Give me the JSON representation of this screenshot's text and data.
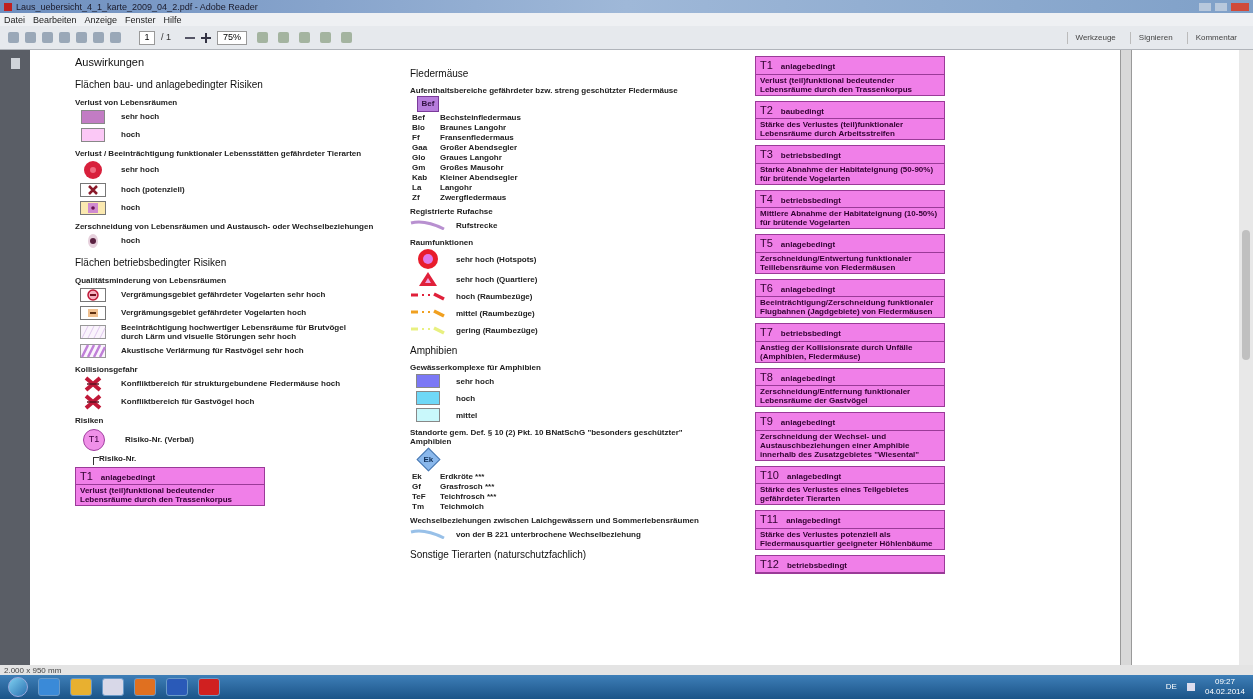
{
  "window": {
    "title": "Laus_uebersicht_4_1_karte_2009_04_2.pdf - Adobe Reader"
  },
  "menu": [
    "Datei",
    "Bearbeiten",
    "Anzeige",
    "Fenster",
    "Hilfe"
  ],
  "toolbar": {
    "page": "1",
    "page_count": "/ 1",
    "zoom": "75%",
    "panels": [
      "Werkzeuge",
      "Signieren",
      "Kommentar"
    ]
  },
  "columns": [
    [
      {
        "kind": "heading",
        "text": "Auswirkungen"
      },
      {
        "kind": "heading2",
        "text": "Flächen bau- und anlagebedingter Risiken"
      },
      {
        "kind": "label",
        "text": "Verlust von Lebensräumen"
      },
      {
        "kind": "swatch",
        "color": "#c27cc4",
        "text": "sehr hoch"
      },
      {
        "kind": "swatch",
        "color": "#fbc8f6",
        "text": "hoch"
      },
      {
        "kind": "label",
        "text": "Verlust / Beeinträchtigung funktionaler Lebensstätten gefährdeter Tierarten"
      },
      {
        "kind": "red-dot",
        "text": "sehr hoch"
      },
      {
        "kind": "cross-box",
        "text": "hoch (potenziell)"
      },
      {
        "kind": "dot-box",
        "text": "hoch"
      },
      {
        "kind": "label",
        "text": "Zerschneidung von Lebensräumen und Austausch- oder Wechselbeziehungen"
      },
      {
        "kind": "small-mark",
        "text": "hoch"
      },
      {
        "kind": "heading2",
        "text": "Flächen betriebsbedingter Risiken"
      },
      {
        "kind": "label",
        "text": "Qualitätsminderung von Lebensräumen"
      },
      {
        "kind": "ring-box",
        "text": "Vergrämungsgebiet gefährdeter Vogelarten sehr hoch"
      },
      {
        "kind": "tan-box",
        "text": "Vergrämungsgebiet gefährdeter Vogelarten hoch"
      },
      {
        "kind": "hatch-light",
        "text": "Beeinträchtigung hochwertiger Lebensräume für Brutvögel durch Lärm und visuelle Störungen sehr hoch"
      },
      {
        "kind": "hatch-dark",
        "text": "Akustische Verlärmung für Rastvögel sehr hoch"
      },
      {
        "kind": "label",
        "text": "Kollisionsgefahr"
      },
      {
        "kind": "red-cross",
        "text": "Konfliktbereich für strukturgebundene Fledermäuse hoch"
      },
      {
        "kind": "red-cross",
        "text": "Konfliktbereich für Gastvögel hoch"
      },
      {
        "kind": "label",
        "text": "Risiken"
      },
      {
        "kind": "marker",
        "code": "T1",
        "text": "Risiko-Nr. (Verbal)"
      },
      {
        "kind": "callout",
        "text": "Risiko-Nr."
      },
      {
        "kind": "card",
        "number": "T1",
        "type": "anlagebedingt",
        "text": "Verlust (teil)funktional bedeutender Lebensräume durch den Trassenkorpus"
      }
    ],
    [
      {
        "kind": "heading2",
        "text": "Fledermäuse"
      },
      {
        "kind": "label",
        "text": "Aufenthaltsbereiche gefährdeter bzw. streng geschützter Fledermäuse"
      },
      {
        "kind": "bat-box",
        "code": "Bef"
      },
      {
        "kind": "abbr",
        "code": "Bef",
        "text": "Bechsteinfledermaus"
      },
      {
        "kind": "abbr",
        "code": "Blo",
        "text": "Braunes Langohr"
      },
      {
        "kind": "abbr",
        "code": "Ff",
        "text": "Fransenfledermaus"
      },
      {
        "kind": "abbr",
        "code": "Gaa",
        "text": "Großer Abendsegler"
      },
      {
        "kind": "abbr",
        "code": "Glo",
        "text": "Graues Langohr"
      },
      {
        "kind": "abbr",
        "code": "Gm",
        "text": "Großes Mausohr"
      },
      {
        "kind": "abbr",
        "code": "Kab",
        "text": "Kleiner Abendsegler"
      },
      {
        "kind": "abbr",
        "code": "La",
        "text": "Langohr"
      },
      {
        "kind": "abbr",
        "code": "Zf",
        "text": "Zwergfledermaus"
      },
      {
        "kind": "label",
        "text": "Registrierte Rufachse"
      },
      {
        "kind": "violet-line",
        "text": "Rufstrecke"
      },
      {
        "kind": "label",
        "text": "Raumfunktionen"
      },
      {
        "kind": "ring",
        "text": "sehr hoch (Hotspots)"
      },
      {
        "kind": "triangle",
        "text": "sehr hoch (Quartiere)"
      },
      {
        "kind": "dash",
        "color": "#e0203a",
        "text": "hoch (Raumbezüge)"
      },
      {
        "kind": "dash",
        "color": "#f0a020",
        "text": "mittel (Raumbezüge)"
      },
      {
        "kind": "dash",
        "color": "#e8f080",
        "text": "gering (Raumbezüge)"
      },
      {
        "kind": "heading2",
        "text": "Amphibien"
      },
      {
        "kind": "label",
        "text": "Gewässerkomplexe für Amphibien"
      },
      {
        "kind": "swatch",
        "color": "#7b78f5",
        "text": "sehr hoch"
      },
      {
        "kind": "swatch",
        "color": "#6fd8f7",
        "text": "hoch"
      },
      {
        "kind": "swatch",
        "color": "#c9f8fb",
        "text": "mittel"
      },
      {
        "kind": "label",
        "text": "Standorte gem. Def. § 10 (2) Pkt. 10 BNatSchG \"besonders geschützter\" Amphibien"
      },
      {
        "kind": "diamond",
        "code": "Ek"
      },
      {
        "kind": "abbr",
        "code": "Ek",
        "text": "Erdkröte ***"
      },
      {
        "kind": "abbr",
        "code": "Gf",
        "text": "Grasfrosch ***"
      },
      {
        "kind": "abbr",
        "code": "TeF",
        "text": "Teichfrosch ***"
      },
      {
        "kind": "abbr",
        "code": "Tm",
        "text": "Teichmolch"
      },
      {
        "kind": "label",
        "text": "Wechselbeziehungen zwischen Laichgewässern und Sommerlebensräumen"
      },
      {
        "kind": "blue-line",
        "text": "von der B 221 unterbrochene Wechselbeziehung"
      },
      {
        "kind": "heading2",
        "text": "Sonstige Tierarten (naturschutzfachlich)"
      }
    ],
    [
      {
        "kind": "card",
        "number": "T1",
        "type": "anlagebedingt",
        "text": "Verlust (teil)funktional bedeutender Lebensräume durch den Trassenkorpus"
      },
      {
        "kind": "card",
        "number": "T2",
        "type": "baubedingt",
        "text": "Stärke des Verlustes (teil)funktionaler Lebensräume durch Arbeitsstreifen"
      },
      {
        "kind": "card",
        "number": "T3",
        "type": "betriebsbedingt",
        "text": "Starke Abnahme der Habitateignung (50-90%) für brütende Vogelarten"
      },
      {
        "kind": "card",
        "number": "T4",
        "type": "betriebsbedingt",
        "text": "Mittlere Abnahme der Habitateignung (10-50%) für brütende Vogelarten"
      },
      {
        "kind": "card",
        "number": "T5",
        "type": "anlagebedingt",
        "text": "Zerschneidung/Entwertung funktionaler Teillebensräume von Fledermäusen"
      },
      {
        "kind": "card",
        "number": "T6",
        "type": "anlagebedingt",
        "text": "Beeinträchtigung/Zerschneidung funktionaler Flugbahnen (Jagdgebiete) von Fledermäusen"
      },
      {
        "kind": "card",
        "number": "T7",
        "type": "betriebsbedingt",
        "text": "Anstieg der Kollisionsrate durch Unfälle (Amphibien, Fledermäuse)"
      },
      {
        "kind": "card",
        "number": "T8",
        "type": "anlagebedingt",
        "text": "Zerschneidung/Entfernung funktionaler Lebensräume der Gastvögel"
      },
      {
        "kind": "card",
        "number": "T9",
        "type": "anlagebedingt",
        "text": "Zerschneidung der Wechsel- und Austauschbeziehungen einer Amphibie innerhalb des Zusatzgebietes \"Wiesental\""
      },
      {
        "kind": "card",
        "number": "T10",
        "type": "anlagebedingt",
        "text": "Stärke des Verlustes eines Teilgebietes gefährdeter Tierarten"
      },
      {
        "kind": "card",
        "number": "T11",
        "type": "anlagebedingt",
        "text": "Stärke des Verlustes potenziell als Fledermausquartier geeigneter Höhlenbäume"
      },
      {
        "kind": "card",
        "number": "T12",
        "type": "betriebsbedingt"
      }
    ]
  ],
  "status_bar": {
    "page_size": "2.000 x 950 mm"
  },
  "taskbar": {
    "language": "DE",
    "time": "09:27",
    "date": "04.02.2014"
  }
}
